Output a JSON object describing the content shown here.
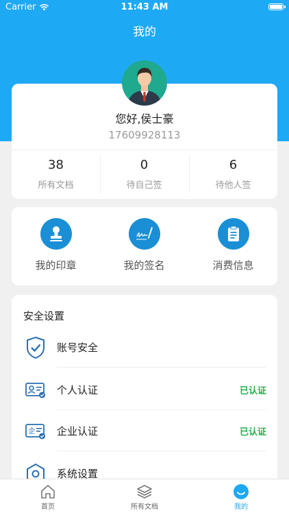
{
  "status": {
    "carrier": "Carrier",
    "time": "11:43 AM"
  },
  "header": {
    "title": "我的"
  },
  "profile": {
    "greeting": "您好,侯士豪",
    "phone": "17609928113"
  },
  "stats": [
    {
      "value": "38",
      "label": "所有文档"
    },
    {
      "value": "0",
      "label": "待自己签"
    },
    {
      "value": "6",
      "label": "待他人签"
    }
  ],
  "tools": [
    {
      "label": "我的印章",
      "icon": "seal-icon"
    },
    {
      "label": "我的签名",
      "icon": "signature-icon"
    },
    {
      "label": "消费信息",
      "icon": "clipboard-icon"
    }
  ],
  "security": {
    "title": "安全设置",
    "items": [
      {
        "label": "账号安全",
        "status": "",
        "icon": "shield-check-icon"
      },
      {
        "label": "个人认证",
        "status": "已认证",
        "icon": "id-card-icon"
      },
      {
        "label": "企业认证",
        "status": "已认证",
        "icon": "enterprise-cert-icon"
      },
      {
        "label": "系统设置",
        "status": "",
        "icon": "settings-icon"
      }
    ]
  },
  "tabs": [
    {
      "label": "首页",
      "icon": "home-icon"
    },
    {
      "label": "所有文档",
      "icon": "layers-icon"
    },
    {
      "label": "我的",
      "icon": "me-icon"
    }
  ],
  "colors": {
    "primary": "#1ea9f4",
    "icon_blue": "#1a8fd6",
    "verified_green": "#22b14c",
    "background": "#f0f0f0"
  }
}
